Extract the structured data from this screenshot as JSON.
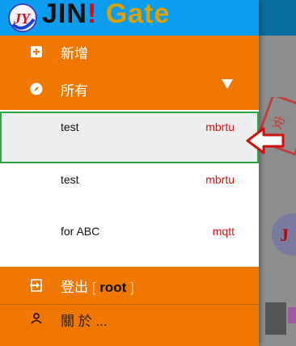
{
  "header": {
    "title_jin": "JIN",
    "title_bang": "!",
    "title_gate": " Gate",
    "logo_text": "JY"
  },
  "menu": {
    "add_label": "新增",
    "all_label": "所有",
    "logout_prefix": "登出 ",
    "logout_bracket_open": "[",
    "logout_user": " root ",
    "logout_bracket_close": "]",
    "about_label": "關 於 ..."
  },
  "devices": [
    {
      "name": "test",
      "protocol": "mbrtu",
      "selected": true
    },
    {
      "name": "test",
      "protocol": "mbrtu",
      "selected": false
    },
    {
      "name": "for ABC",
      "protocol": "mqtt",
      "selected": false
    }
  ],
  "colors": {
    "header": "#0b9ef0",
    "accent": "#f07800",
    "protocol": "#e01010",
    "selection_border": "#27a643"
  },
  "icons": [
    "plus-box-icon",
    "compass-icon",
    "chevron-down-icon",
    "logout-icon",
    "person-icon"
  ]
}
